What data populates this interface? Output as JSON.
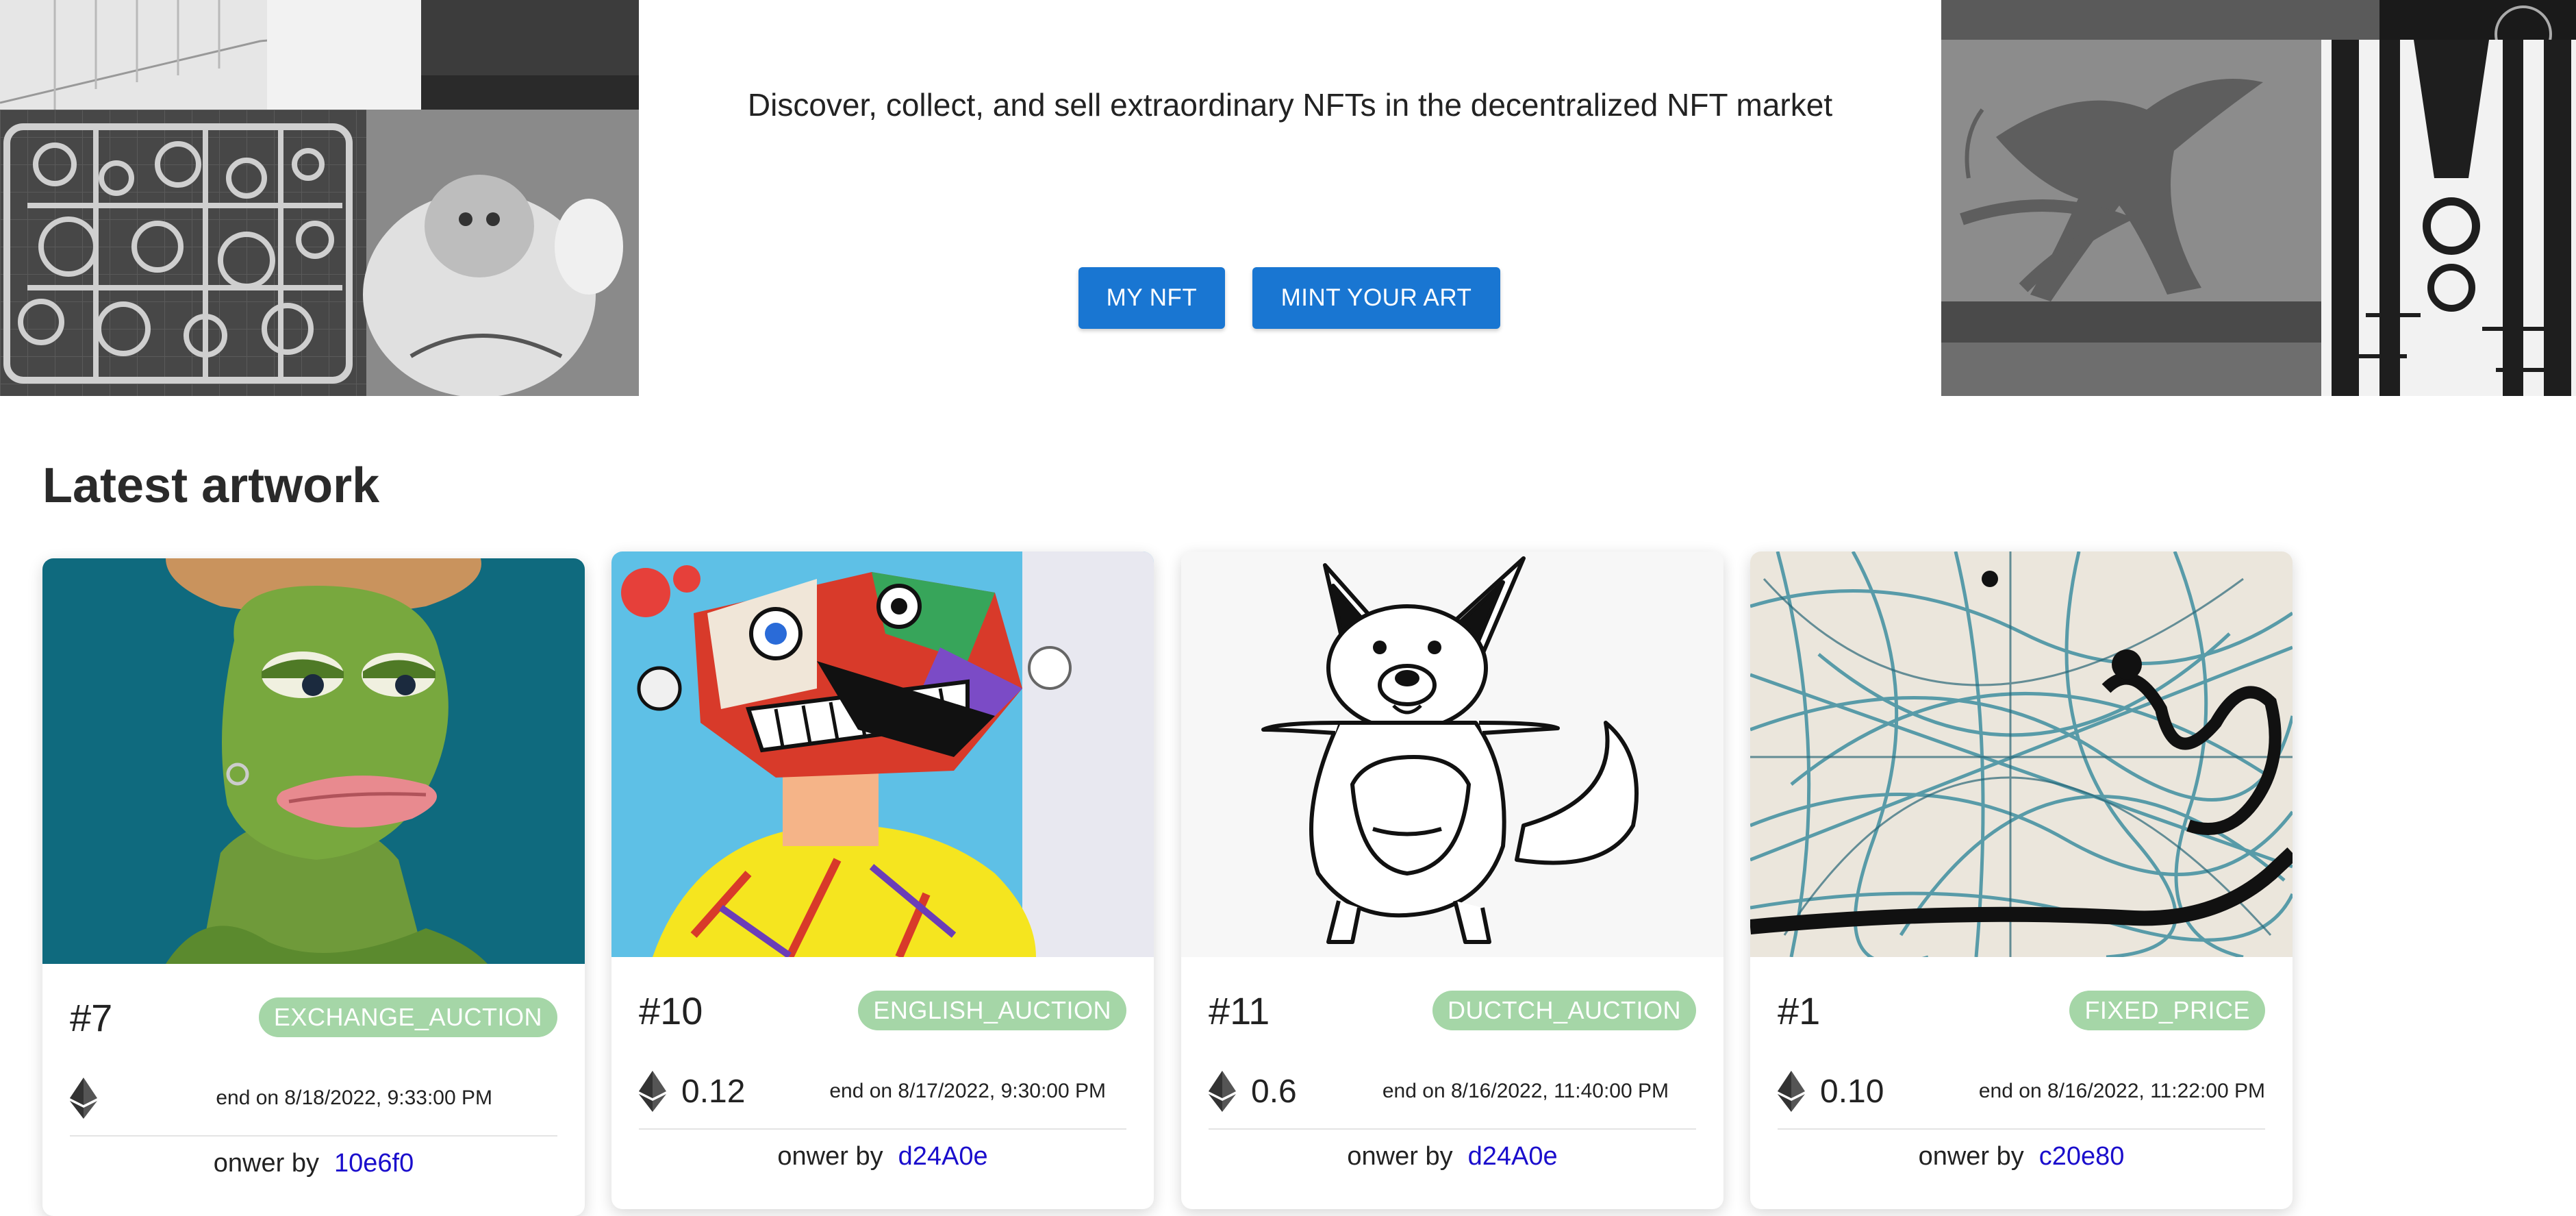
{
  "hero": {
    "tagline": "Discover, collect, and sell extraordinary NFTs in the decentralized NFT market",
    "buttons": {
      "my_nft": "MY NFT",
      "mint": "MINT YOUR ART"
    }
  },
  "section": {
    "title": "Latest artwork"
  },
  "owner_prefix": "onwer by",
  "cards": [
    {
      "id": "#7",
      "sale_type": "EXCHANGE_AUCTION",
      "price": "",
      "end": "end on 8/18/2022, 9:33:00 PM",
      "owner": "10e6f0",
      "art_icon": "frog-character-art"
    },
    {
      "id": "#10",
      "sale_type": "ENGLISH_AUCTION",
      "price": "0.12",
      "end": "end on 8/17/2022, 9:30:00 PM",
      "owner": "d24A0e",
      "art_icon": "abstract-face-painting-art"
    },
    {
      "id": "#11",
      "sale_type": "DUCTCH_AUCTION",
      "price": "0.6",
      "end": "end on 8/16/2022, 11:40:00 PM",
      "owner": "d24A0e",
      "art_icon": "kangaroo-sketch-art"
    },
    {
      "id": "#1",
      "sale_type": "FIXED_PRICE",
      "price": "0.10",
      "end": "end on 8/16/2022, 11:22:00 PM",
      "owner": "c20e80",
      "art_icon": "tangled-lines-art"
    }
  ],
  "colors": {
    "primary_button": "#1976d2",
    "badge": "#a5d6a7",
    "owner_link": "#1a0dcc"
  }
}
